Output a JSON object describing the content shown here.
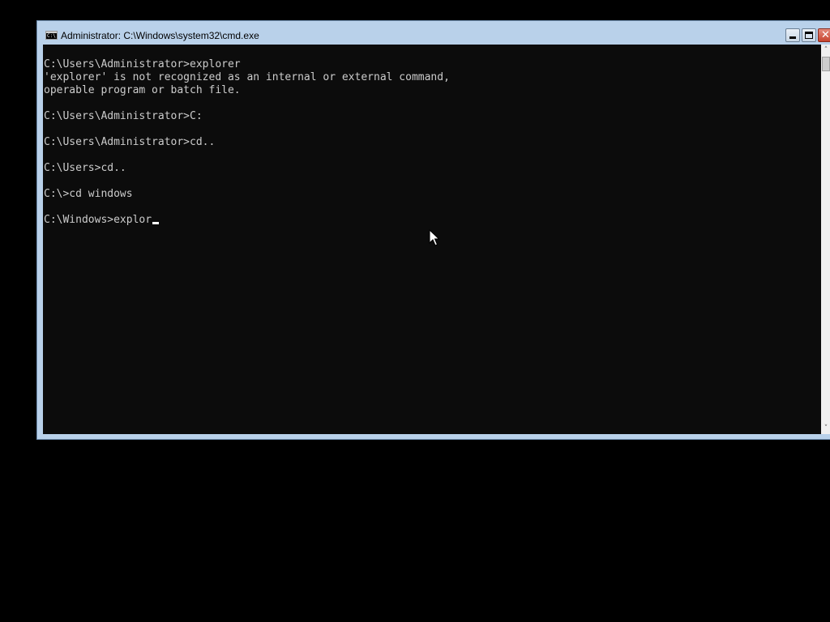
{
  "window": {
    "title": "Administrator: C:\\Windows\\system32\\cmd.exe",
    "icon": "cmd-icon",
    "icon_glyph": "C:\\",
    "controls": {
      "minimize": "minimize-icon",
      "maximize": "maximize-icon",
      "close": "close-icon",
      "close_glyph": "✕"
    }
  },
  "console": {
    "lines": [
      "C:\\Users\\Administrator>explorer",
      "'explorer' is not recognized as an internal or external command,",
      "operable program or batch file.",
      "",
      "C:\\Users\\Administrator>C:",
      "",
      "C:\\Users\\Administrator>cd..",
      "",
      "C:\\Users>cd..",
      "",
      "C:\\>cd windows",
      ""
    ],
    "current_input": "C:\\Windows>explor",
    "background": "#0c0c0c",
    "foreground": "#cccccc"
  },
  "scrollbar": {
    "up_arrow": "˄",
    "down_arrow": "˅"
  },
  "colors": {
    "desktop": "#000000",
    "window_frame": "#b9d1ea",
    "close_button": "#c7442f"
  }
}
